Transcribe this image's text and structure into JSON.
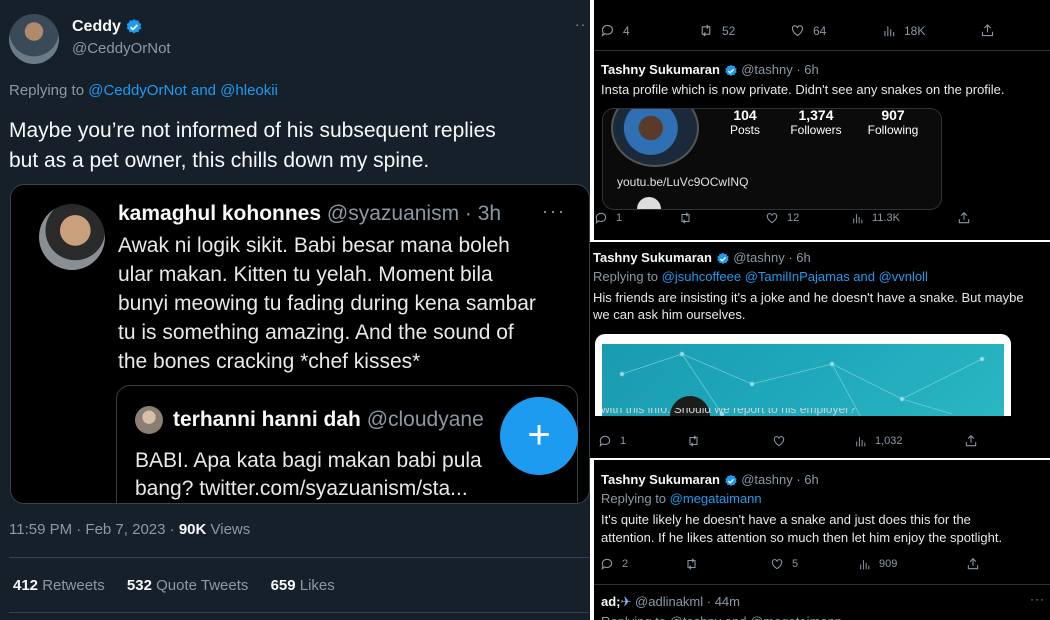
{
  "left": {
    "author_name": "Ceddy",
    "author_handle": "@CeddyOrNot",
    "replying_prefix": "Replying to",
    "replying_to": "@CeddyOrNot and @hleokii",
    "tweet_text_line1": "Maybe you’re not informed of his subsequent replies",
    "tweet_text_line2": "but as a pet owner, this chills down my spine.",
    "embedded": {
      "name": "kamaghul kohonnes",
      "handle_time": "@syazuanism · 3h",
      "text_lines": [
        "Awak ni logik sikit. Babi besar mana boleh",
        "ular makan. Kitten tu yelah. Moment bila",
        "bunyi meowing tu fading during kena sambar",
        "tu is something amazing. And the sound of",
        "the bones cracking *chef kisses*"
      ],
      "quoted": {
        "name": "terhanni hanni dah",
        "handle": "@cloudyane",
        "text_line1": "BABI. Apa kata bagi makan babi pula",
        "text_line2": "bang? twitter.com/syazuanism/sta..."
      }
    },
    "fab_label": "+",
    "timestamp": "11:59 PM · Feb 7, 2023 · ",
    "views_count": "90K",
    "views_label": " Views",
    "stats": {
      "retweets_count": "412",
      "retweets_label": " Retweets",
      "quotes_count": "532",
      "quotes_label": " Quote Tweets",
      "likes_count": "659",
      "likes_label": " Likes"
    }
  },
  "right_top": {
    "actions": {
      "replies": "4",
      "retweets": "52",
      "likes": "64",
      "views": "18K"
    },
    "reply": {
      "name": "Tashny Sukumaran",
      "handle_time": "@tashny · 6h",
      "text": "Insta profile which is now private. Didn't see any snakes on the profile.",
      "profile": {
        "posts_count": "104",
        "posts_label": "Posts",
        "followers_count": "1,374",
        "followers_label": "Followers",
        "following_count": "907",
        "following_label": "Following",
        "link": "youtu.be/LuVc9OCwINQ"
      },
      "actions": {
        "replies": "1",
        "retweets": "",
        "likes": "12",
        "views": "11.3K"
      }
    }
  },
  "right_mid": {
    "name": "Tashny Sukumaran",
    "handle_time": "@tashny · 6h",
    "replying_prefix": "Replying to",
    "replying_to": "@jsuhcoffeee @TamilInPajamas and @vvnloll",
    "text_line1": "His friends are insisting it's a joke and he doesn't have a snake. But maybe",
    "text_line2": "we can ask him ourselves.",
    "image_caption": "with this info. Should we report to his employer?",
    "actions": {
      "replies": "1",
      "retweets": "",
      "likes": "",
      "views": "1,032"
    }
  },
  "right_bottom": {
    "name": "Tashny Sukumaran",
    "handle_time": "@tashny · 6h",
    "replying_prefix": "Replying to",
    "replying_to": "@megataimann",
    "text_line1": "It's quite likely he doesn't have a snake and just does this for the",
    "text_line2": "attention. If he likes attention so much then let him enjoy the spotlight.",
    "actions": {
      "replies": "2",
      "retweets": "",
      "likes": "5",
      "views": "909"
    },
    "next": {
      "name": "ad;",
      "handle_time": "@adlinakml · 44m",
      "replying_partial": "Replying to @tashny and @megataimann"
    }
  }
}
